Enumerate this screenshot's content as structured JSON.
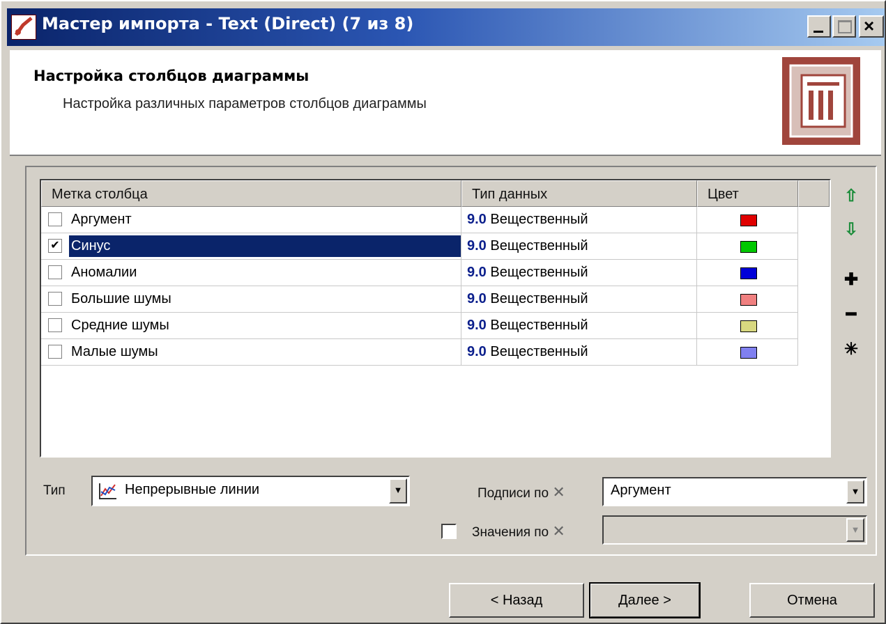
{
  "window": {
    "title": "Мастер импорта - Text (Direct) (7 из 8)"
  },
  "header": {
    "title": "Настройка столбцов диаграммы",
    "subtitle": "Настройка различных параметров столбцов диаграммы"
  },
  "grid": {
    "columns": [
      "Метка столбца",
      "Тип данных",
      "Цвет"
    ],
    "rows": [
      {
        "label": "Аргумент",
        "checked": false,
        "type_num": "9.0",
        "type_name": "Вещественный",
        "color": "#e00000"
      },
      {
        "label": "Синус",
        "checked": true,
        "selected": true,
        "type_num": "9.0",
        "type_name": "Вещественный",
        "color": "#00c800"
      },
      {
        "label": "Аномалии",
        "checked": false,
        "type_num": "9.0",
        "type_name": "Вещественный",
        "color": "#0000d8"
      },
      {
        "label": "Большие шумы",
        "checked": false,
        "type_num": "9.0",
        "type_name": "Вещественный",
        "color": "#f08080"
      },
      {
        "label": "Средние шумы",
        "checked": false,
        "type_num": "9.0",
        "type_name": "Вещественный",
        "color": "#d8d880"
      },
      {
        "label": "Малые шумы",
        "checked": false,
        "type_num": "9.0",
        "type_name": "Вещественный",
        "color": "#8080f0"
      }
    ]
  },
  "side_tools": [
    {
      "icon": "arrow-up-icon",
      "glyph": "⇧",
      "color": "#1b8c3a"
    },
    {
      "icon": "arrow-down-icon",
      "glyph": "⇩",
      "color": "#1b8c3a"
    },
    {
      "icon": "plus-icon",
      "glyph": "✚",
      "color": "#000"
    },
    {
      "icon": "minus-icon",
      "glyph": "━",
      "color": "#000"
    },
    {
      "icon": "asterisk-icon",
      "glyph": "✳",
      "color": "#000"
    }
  ],
  "type_field": {
    "label": "Тип",
    "value": "Непрерывные линии"
  },
  "x_labels_field": {
    "label": "Подписи по",
    "value": "Аргумент"
  },
  "x_values_field": {
    "label": "Значения по",
    "checked": false,
    "value": ""
  },
  "buttons": {
    "back": "< Назад",
    "next": "Далее >",
    "cancel": "Отмена"
  }
}
